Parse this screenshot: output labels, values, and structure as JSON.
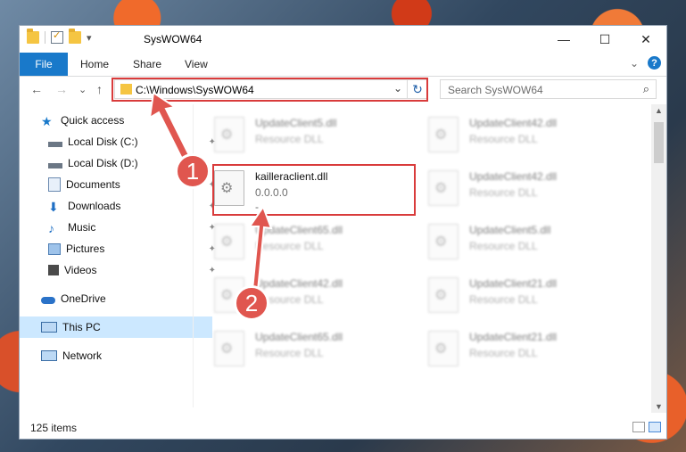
{
  "window": {
    "title": "SysWOW64",
    "qat": [
      "folder-icon",
      "properties-icon",
      "new-folder-icon",
      "customize-icon"
    ]
  },
  "controls": {
    "minimize": "—",
    "maximize": "☐",
    "close": "✕"
  },
  "ribbon": {
    "tabs": [
      "File",
      "Home",
      "Share",
      "View"
    ],
    "expand": "⌄",
    "help": "?"
  },
  "nav": {
    "back": "←",
    "forward": "→",
    "recent": "⌄",
    "up": "↑",
    "address": "C:\\Windows\\SysWOW64",
    "address_dropdown": "⌄",
    "refresh": "↻",
    "search_placeholder": "Search SysWOW64",
    "search_icon": "⌕"
  },
  "sidebar": {
    "items": [
      {
        "label": "Quick access",
        "icon": "star-icon",
        "pinned": false
      },
      {
        "label": "Local Disk (C:)",
        "icon": "drive-icon",
        "pinned": true
      },
      {
        "label": "Local Disk (D:)",
        "icon": "drive-icon",
        "pinned": false
      },
      {
        "label": "Documents",
        "icon": "documents-icon",
        "pinned": true
      },
      {
        "label": "Downloads",
        "icon": "downloads-icon",
        "pinned": true
      },
      {
        "label": "Music",
        "icon": "music-icon",
        "pinned": true
      },
      {
        "label": "Pictures",
        "icon": "pictures-icon",
        "pinned": true
      },
      {
        "label": "Videos",
        "icon": "videos-icon",
        "pinned": true
      },
      {
        "label": "OneDrive",
        "icon": "onedrive-icon",
        "pinned": false
      },
      {
        "label": "This PC",
        "icon": "computer-icon",
        "pinned": false,
        "selected": true
      },
      {
        "label": "Network",
        "icon": "network-icon",
        "pinned": false
      }
    ],
    "pin_glyph": "📌"
  },
  "files": {
    "left": [
      {
        "name": "UpdateClient5.dll",
        "sub": "Resource DLL",
        "blurred": true
      },
      {
        "name": "kailleraclient.dll",
        "sub": "0.0.0.0",
        "sub2": "-",
        "blurred": false,
        "highlighted": true
      },
      {
        "name": "UpdateClient65.dll",
        "sub": "Resource DLL",
        "blurred": true
      },
      {
        "name": "UpdateClient42.dll",
        "sub": "Resource DLL",
        "blurred": true
      },
      {
        "name": "UpdateClient65.dll",
        "sub": "Resource DLL",
        "blurred": true
      }
    ],
    "right": [
      {
        "name": "UpdateClient42.dll",
        "sub": "Resource DLL",
        "blurred": true
      },
      {
        "name": "UpdateClient42.dll",
        "sub": "Resource DLL",
        "blurred": true
      },
      {
        "name": "UpdateClient5.dll",
        "sub": "Resource DLL",
        "blurred": true
      },
      {
        "name": "UpdateClient21.dll",
        "sub": "Resource DLL",
        "blurred": true
      },
      {
        "name": "UpdateClient21.dll",
        "sub": "Resource DLL",
        "blurred": true
      }
    ]
  },
  "status": {
    "count": "125 items"
  },
  "callouts": [
    "1",
    "2"
  ],
  "colors": {
    "accent": "#1979ca",
    "highlight": "#d93b3b",
    "callout": "#e0564f"
  }
}
